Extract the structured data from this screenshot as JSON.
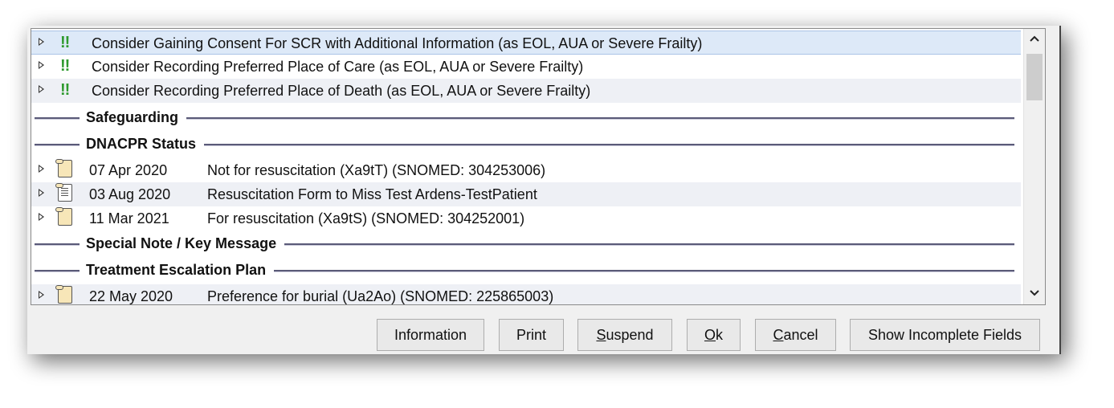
{
  "alerts": [
    {
      "marker": "!!",
      "text": "Consider Gaining Consent For SCR with Additional Information (as EOL, AUA or Severe Frailty)"
    },
    {
      "marker": "!!",
      "text": "Consider Recording Preferred Place of Care (as EOL, AUA or Severe Frailty)"
    },
    {
      "marker": "!!",
      "text": "Consider Recording Preferred Place of Death (as EOL, AUA or Severe Frailty)"
    }
  ],
  "sections": {
    "safeguarding": "Safeguarding",
    "dnacpr": "DNACPR Status",
    "special_note": "Special Note / Key Message",
    "treatment_escalation": "Treatment Escalation Plan"
  },
  "dnacpr_entries": [
    {
      "date": "07 Apr 2020",
      "desc": "Not for resuscitation (Xa9tT) (SNOMED: 304253006)",
      "icon": "scroll-icon"
    },
    {
      "date": "03 Aug 2020",
      "desc": "Resuscitation Form to Miss Test Ardens-TestPatient",
      "icon": "form-document-icon"
    },
    {
      "date": "11 Mar 2021",
      "desc": "For resuscitation (Xa9tS) (SNOMED: 304252001)",
      "icon": "scroll-icon"
    }
  ],
  "treatment_entries": [
    {
      "date": "22 May 2020",
      "desc": "Preference for burial (Ua2Ao) (SNOMED: 225865003)",
      "icon": "scroll-icon"
    }
  ],
  "scrollbar": {
    "up": "^",
    "down": "v"
  },
  "buttons": {
    "information": "Information",
    "print": "Print",
    "suspend_key": "S",
    "suspend_rest": "uspend",
    "ok_key": "O",
    "ok_rest": "k",
    "cancel_key": "C",
    "cancel_rest": "ancel",
    "show_incomplete": "Show Incomplete Fields"
  }
}
